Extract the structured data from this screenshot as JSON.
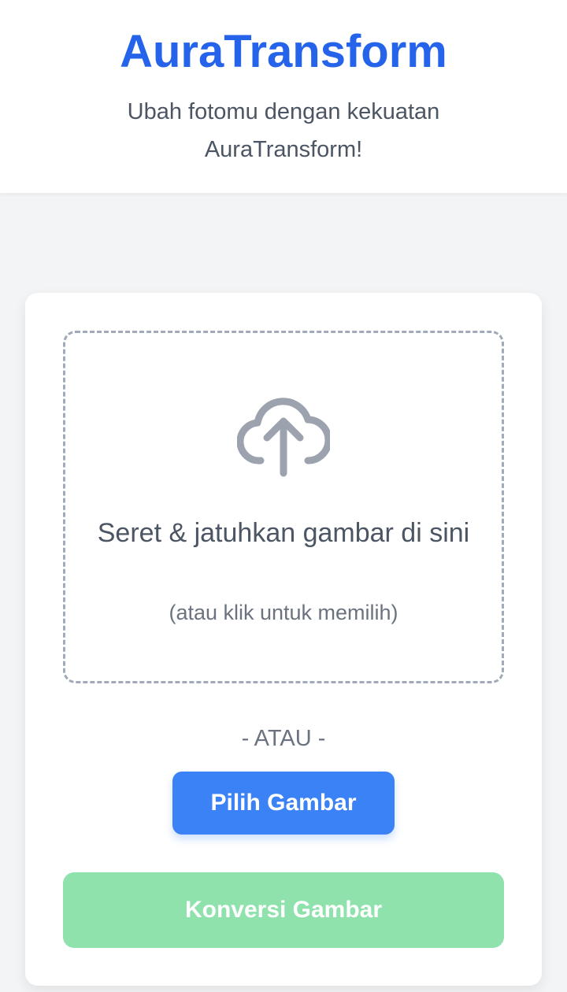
{
  "header": {
    "title": "AuraTransform",
    "subtitle": "Ubah fotomu dengan kekuatan AuraTransform!"
  },
  "dropzone": {
    "icon": "cloud-upload-icon",
    "main_text": "Seret & jatuhkan gambar di sini",
    "hint_text": "(atau klik untuk memilih)"
  },
  "divider": {
    "label": "- ATAU -"
  },
  "buttons": {
    "choose_label": "Pilih Gambar",
    "convert_label": "Konversi Gambar"
  },
  "colors": {
    "brand": "#2563eb",
    "primary_button": "#3b82f6",
    "convert_button_disabled": "#90e2ad",
    "dropzone_border": "#a0aab8",
    "background": "#f3f4f6"
  }
}
